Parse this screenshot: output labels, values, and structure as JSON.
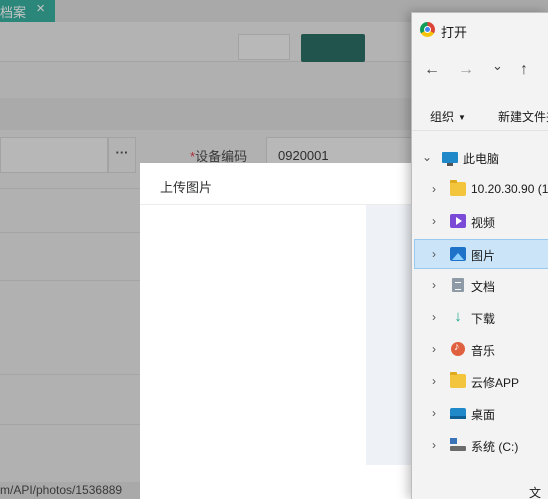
{
  "background_app": {
    "tab_label": "档案",
    "tab_close": "×",
    "more_button": "···",
    "device_code_label": "设备编码",
    "required_mark": "*",
    "device_code_value": "0920001",
    "status_url": "m/API/photos/1536889",
    "accent_color": "#1fa594"
  },
  "upload_dialog": {
    "title": "上传图片"
  },
  "file_dialog": {
    "title": "打开",
    "nav": {
      "back": "←",
      "forward": "→",
      "recent": "⌄",
      "up": "↑"
    },
    "toolbar": {
      "organize": "组织",
      "organize_caret": "▼",
      "new_folder": "新建文件夹"
    },
    "tree": [
      {
        "label": "此电脑",
        "icon": "this-pc-icon",
        "expanded": true
      },
      {
        "label": "10.20.30.90 (1",
        "icon": "folder-icon",
        "expanded": false
      },
      {
        "label": "视频",
        "icon": "video-icon",
        "expanded": false
      },
      {
        "label": "图片",
        "icon": "pictures-icon",
        "expanded": false,
        "selected": true
      },
      {
        "label": "文档",
        "icon": "documents-icon",
        "expanded": false
      },
      {
        "label": "下载",
        "icon": "download-icon",
        "expanded": false
      },
      {
        "label": "音乐",
        "icon": "music-icon",
        "expanded": false
      },
      {
        "label": "云修APP",
        "icon": "folder-icon",
        "expanded": false
      },
      {
        "label": "桌面",
        "icon": "desktop-icon",
        "expanded": false
      },
      {
        "label": "系统 (C:)",
        "icon": "drive-icon",
        "expanded": false
      }
    ],
    "chevron_collapsed": "›",
    "chevron_expanded": "⌄",
    "footer_text": "文",
    "selection_color": "#cce4f7"
  }
}
